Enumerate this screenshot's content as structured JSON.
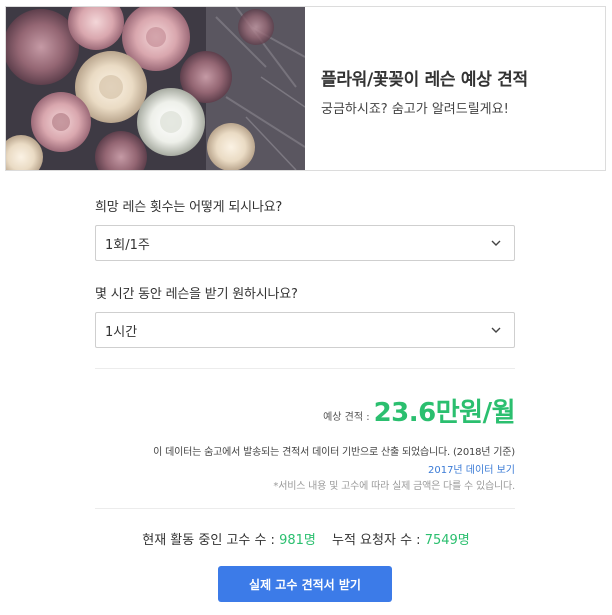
{
  "hero": {
    "title": "플라워/꽃꽂이 레슨 예상 견적",
    "subtitle": "궁금하시죠? 숨고가 알려드릴게요!"
  },
  "questions": [
    {
      "label": "희망 레슨 횟수는 어떻게 되시나요?",
      "selected": "1회/1주",
      "icon": "chevron-down-icon"
    },
    {
      "label": "몇 시간 동안 레슨을 받기 원하시나요?",
      "selected": "1시간",
      "icon": "chevron-down-icon"
    }
  ],
  "estimate": {
    "label": "예상 견적 :",
    "value": "23.6만원/월"
  },
  "notes": {
    "basis": "이 데이터는 숨고에서 발송되는 견적서 데이터 기반으로 산출 되었습니다. (2018년 기준)",
    "link": "2017년 데이터 보기",
    "disclaimer": "*서비스 내용 및 고수에 따라 실제 금액은 다를 수 있습니다."
  },
  "stats": {
    "active_label": "현재 활동 중인 고수 수 :",
    "active_value": "981명",
    "requests_label": "누적 요청자 수 :",
    "requests_value": "7549명"
  },
  "cta": {
    "label": "실제 고수 견적서 받기"
  },
  "colors": {
    "accent_green": "#2bbf6f",
    "link_blue": "#3b7bd6",
    "button_blue": "#3c7be8"
  }
}
